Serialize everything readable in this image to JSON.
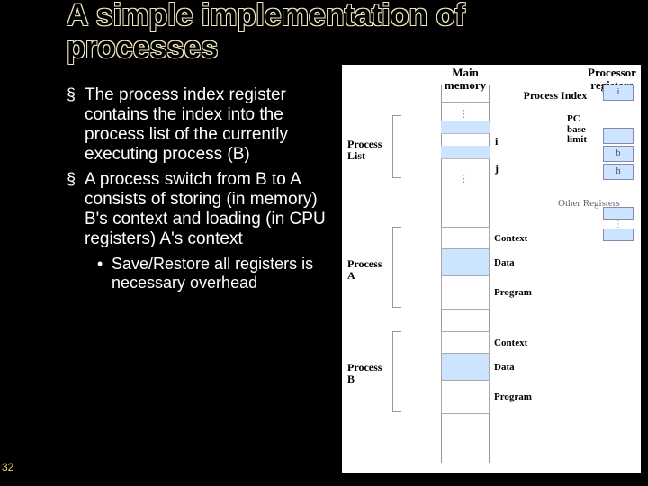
{
  "slide": {
    "number": "32",
    "title": "A simple implementation of processes"
  },
  "bullets": {
    "b1": "The process index register contains the index into the process list of the currently executing process (B)",
    "b2": "A process switch from B to A consists of storing (in memory) B's context and loading (in CPU registers) A's context",
    "b2a": "Save/Restore all registers is necessary overhead"
  },
  "fig": {
    "main_memory": "Main memory",
    "processor_registers": "Processor registers",
    "process_index": "Process Index",
    "pc": "PC",
    "base": "base",
    "limit": "limit",
    "other_registers": "Other Registers",
    "process_list": "Process List",
    "process_a": "Process A",
    "process_b": "Process B",
    "i": "i",
    "j": "j",
    "reg_i": "i",
    "reg_b": "b",
    "reg_h": "h",
    "context": "Context",
    "data": "Data",
    "program": "Program"
  }
}
